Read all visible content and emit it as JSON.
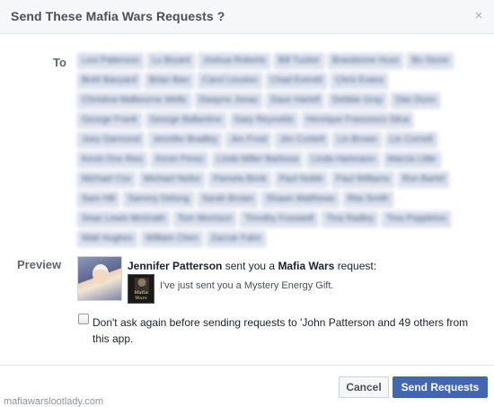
{
  "dialog": {
    "title": "Send These Mafia Wars Requests ?",
    "close_glyph": "×"
  },
  "to": {
    "label": "To",
    "recipients": [
      "Lexi Patterson",
      "Lu Bryant",
      "Joshua Roberts",
      "Bill Tucker",
      "Brandonne Huss",
      "Bo Stone",
      "Brett Banyard",
      "Brian Barr",
      "Carol Lexxton",
      "Chad Everett",
      "Chris Evans",
      "Christina Malbourne Wells",
      "Dwayne Jonas",
      "Dave Hartell",
      "Debbie Gray",
      "Dan Dunn",
      "George Frank",
      "George Ballantine",
      "Gary Reynolds",
      "Henrique Francesco Silva",
      "Joey Darmond",
      "Jennifer Bradley",
      "Jim Frost",
      "Jim Corbell",
      "Lin Brown",
      "Lin Cornell",
      "Kevin Dos Rios",
      "Kevin Perez",
      "Linda Miller Barbosa",
      "Linda Hartmann",
      "Marcia Little",
      "Michael Cox",
      "Michael Neilor",
      "Pamela Brink",
      "Paul Noble",
      "Paul Williams",
      "Ron Bartel",
      "Sam Hill",
      "Sammy Delong",
      "Sarah Brown",
      "Shawn Matthews",
      "Rita Smith",
      "Sean Lewis McGrath",
      "Tom Morrison",
      "Timothy Fosswell",
      "Tina Radley",
      "Tina Poppleton",
      "Walt Hughes",
      "William Chen",
      "Zaccar Fahn"
    ]
  },
  "preview": {
    "label": "Preview",
    "sender_name": "Jennifer Patterson",
    "request_mid": "sent you a",
    "app_name": "Mafia Wars",
    "request_end": "request:",
    "app_thumb_text": "Mafia Wars",
    "message": "I've just sent you a Mystery Energy Gift."
  },
  "option": {
    "checked": false,
    "text": "Don't ask again before sending requests to 'John Patterson and 49 others from this app."
  },
  "footer": {
    "watermark": "mafiawarslootlady.com",
    "cancel_label": "Cancel",
    "send_label": "Send Requests"
  },
  "colors": {
    "primary": "#4267b2",
    "header_bg": "#f6f7f9",
    "chip_bg": "#dde3ee"
  }
}
